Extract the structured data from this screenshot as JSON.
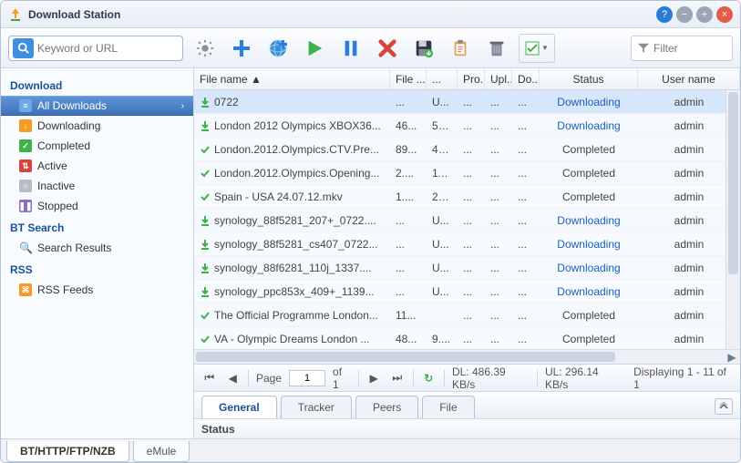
{
  "window": {
    "title": "Download Station"
  },
  "search": {
    "placeholder": "Keyword or URL"
  },
  "filter": {
    "placeholder": "Filter"
  },
  "sidebar": {
    "sections": [
      {
        "title": "Download",
        "items": [
          {
            "label": "All Downloads",
            "icon": "list",
            "selected": true
          },
          {
            "label": "Downloading",
            "icon": "down-arrow"
          },
          {
            "label": "Completed",
            "icon": "check"
          },
          {
            "label": "Active",
            "icon": "active"
          },
          {
            "label": "Inactive",
            "icon": "inactive"
          },
          {
            "label": "Stopped",
            "icon": "pause"
          }
        ]
      },
      {
        "title": "BT Search",
        "items": [
          {
            "label": "Search Results",
            "icon": "magnify"
          }
        ]
      },
      {
        "title": "RSS",
        "items": [
          {
            "label": "RSS Feeds",
            "icon": "rss"
          }
        ]
      }
    ]
  },
  "columns": {
    "name": "File name ▲",
    "filesize": "File ...",
    "downloaded": "...",
    "progress": "Pro...",
    "upload": "Upl...",
    "download": "Do...",
    "status": "Status",
    "username": "User name"
  },
  "rows": [
    {
      "icon": "down",
      "name": "0722",
      "fs": "...",
      "dl": "U...",
      "pr": "...",
      "ul": "...",
      "do": "...",
      "status": "Downloading",
      "status_link": true,
      "user": "admin",
      "sel": true
    },
    {
      "icon": "down",
      "name": "London 2012 Olympics XBOX36...",
      "fs": "46...",
      "dl": "55...",
      "pr": "...",
      "ul": "...",
      "do": "...",
      "status": "Downloading",
      "status_link": true,
      "user": "admin"
    },
    {
      "icon": "done",
      "name": "London.2012.Olympics.CTV.Pre...",
      "fs": "89...",
      "dl": "45...",
      "pr": "...",
      "ul": "...",
      "do": "...",
      "status": "Completed",
      "user": "admin"
    },
    {
      "icon": "done",
      "name": "London.2012.Olympics.Opening...",
      "fs": "2....",
      "dl": "11...",
      "pr": "...",
      "ul": "...",
      "do": "...",
      "status": "Completed",
      "user": "admin"
    },
    {
      "icon": "done",
      "name": "Spain - USA 24.07.12.mkv",
      "fs": "1....",
      "dl": "26...",
      "pr": "...",
      "ul": "...",
      "do": "...",
      "status": "Completed",
      "user": "admin"
    },
    {
      "icon": "down",
      "name": "synology_88f5281_207+_0722....",
      "fs": "...",
      "dl": "U...",
      "pr": "...",
      "ul": "...",
      "do": "...",
      "status": "Downloading",
      "status_link": true,
      "user": "admin"
    },
    {
      "icon": "down",
      "name": "synology_88f5281_cs407_0722...",
      "fs": "...",
      "dl": "U...",
      "pr": "...",
      "ul": "...",
      "do": "...",
      "status": "Downloading",
      "status_link": true,
      "user": "admin"
    },
    {
      "icon": "down",
      "name": "synology_88f6281_110j_1337....",
      "fs": "...",
      "dl": "U...",
      "pr": "...",
      "ul": "...",
      "do": "...",
      "status": "Downloading",
      "status_link": true,
      "user": "admin"
    },
    {
      "icon": "down",
      "name": "synology_ppc853x_409+_1139...",
      "fs": "...",
      "dl": "U...",
      "pr": "...",
      "ul": "...",
      "do": "...",
      "status": "Downloading",
      "status_link": true,
      "user": "admin"
    },
    {
      "icon": "done",
      "name": "The Official Programme London...",
      "fs": "11...",
      "dl": "",
      "pr": "...",
      "ul": "...",
      "do": "...",
      "status": "Completed",
      "user": "admin"
    },
    {
      "icon": "done",
      "name": "VA - Olympic Dreams London ...",
      "fs": "48...",
      "dl": "9....",
      "pr": "...",
      "ul": "...",
      "do": "...",
      "status": "Completed",
      "user": "admin"
    }
  ],
  "pager": {
    "page_label": "Page",
    "page_value": "1",
    "of_label": "of 1",
    "dl_label": "DL: 486.39 KB/s",
    "ul_label": "UL: 296.14 KB/s",
    "display_label": "Displaying 1 - 11 of 1"
  },
  "detail_tabs": [
    "General",
    "Tracker",
    "Peers",
    "File"
  ],
  "detail_head": "Status",
  "bottom_tabs": [
    "BT/HTTP/FTP/NZB",
    "eMule"
  ]
}
